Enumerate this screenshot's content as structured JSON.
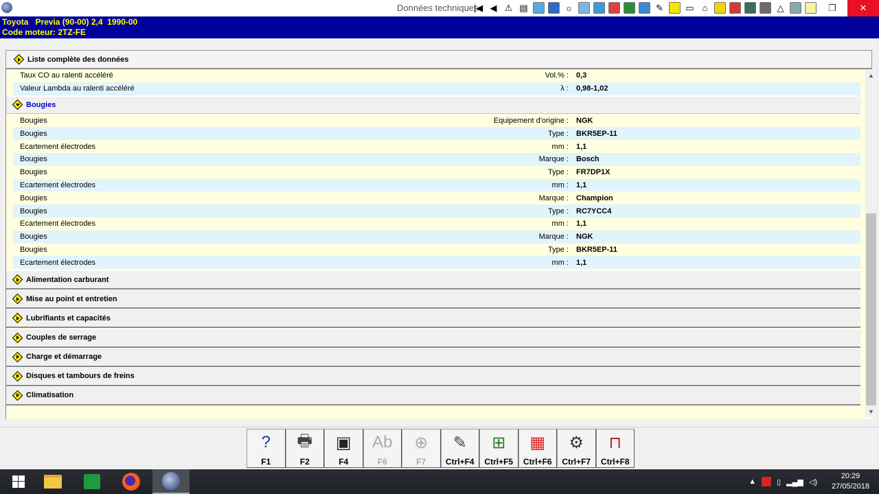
{
  "window": {
    "title": "Données techniques",
    "controls": {
      "restore": "❐",
      "close": "✕"
    }
  },
  "toolbar": {
    "icons": [
      {
        "name": "first-page-icon",
        "glyph": "|◀"
      },
      {
        "name": "previous-icon",
        "glyph": "◀"
      },
      {
        "name": "warning-icon",
        "glyph": "⚠"
      },
      {
        "name": "document-icon",
        "glyph": "▤"
      },
      {
        "name": "diagram-icon",
        "color": "#5aa8e0"
      },
      {
        "name": "globe-icon",
        "color": "#2b6cc4"
      },
      {
        "name": "bulb-icon",
        "glyph": "☼"
      },
      {
        "name": "gauge-icon",
        "color": "#7ab6e6"
      },
      {
        "name": "car-lift-icon",
        "color": "#3c9ad6"
      },
      {
        "name": "battery-icon",
        "color": "#e04040"
      },
      {
        "name": "ramp-icon",
        "color": "#2c8a3c"
      },
      {
        "name": "engine-icon",
        "color": "#3a8ad0"
      },
      {
        "name": "pen-icon",
        "glyph": "✎"
      },
      {
        "name": "dashboard-icon",
        "color": "#f2e600"
      },
      {
        "name": "window-icon",
        "glyph": "▭"
      },
      {
        "name": "car-icon",
        "glyph": "⌂"
      },
      {
        "name": "face-icon",
        "color": "#f2d200"
      },
      {
        "name": "calculator-icon",
        "color": "#d23a3a"
      },
      {
        "name": "wheel-icon",
        "color": "#3f6b5a"
      },
      {
        "name": "tools-icon",
        "color": "#6b6b6b"
      },
      {
        "name": "triangle-icon",
        "glyph": "△"
      },
      {
        "name": "tire-icon",
        "color": "#8aa"
      },
      {
        "name": "notes-icon",
        "color": "#f6f0a0"
      }
    ]
  },
  "vehicle": {
    "line1": "Toyota   Previa (90-00) 2,4  1990-00",
    "line2": "Code moteur: 2TZ-FE"
  },
  "summary_title": "Liste complète des données",
  "top_rows": [
    {
      "name": "Taux CO au ralenti accéléré",
      "unit": "Vol.% :",
      "value": "0,3"
    },
    {
      "name": "Valeur Lambda au ralenti accéléré",
      "unit": "λ :",
      "value": "0,98-1,02"
    }
  ],
  "open_section": "Bougies",
  "bougies_rows": [
    {
      "name": "Bougies",
      "unit": "Equipement d'origine :",
      "value": "NGK"
    },
    {
      "name": "Bougies",
      "unit": "Type :",
      "value": "BKR5EP-11"
    },
    {
      "name": "Ecartement électrodes",
      "unit": "mm :",
      "value": "1,1"
    },
    {
      "name": "Bougies",
      "unit": "Marque :",
      "value": "Bosch"
    },
    {
      "name": "Bougies",
      "unit": "Type :",
      "value": "FR7DP1X"
    },
    {
      "name": "Ecartement électrodes",
      "unit": "mm :",
      "value": "1,1"
    },
    {
      "name": "Bougies",
      "unit": "Marque :",
      "value": "Champion"
    },
    {
      "name": "Bougies",
      "unit": "Type :",
      "value": "RC7YCC4"
    },
    {
      "name": "Ecartement électrodes",
      "unit": "mm :",
      "value": "1,1"
    },
    {
      "name": "Bougies",
      "unit": "Marque :",
      "value": "NGK"
    },
    {
      "name": "Bougies",
      "unit": "Type :",
      "value": "BKR5EP-11"
    },
    {
      "name": "Ecartement électrodes",
      "unit": "mm :",
      "value": "1,1"
    }
  ],
  "sections": [
    "Alimentation carburant",
    "Mise au point et entretien",
    "Lubrifiants et capacités",
    "Couples de serrage",
    "Charge et démarrage",
    "Disques et tambours de freins",
    "Climatisation"
  ],
  "function_keys": [
    {
      "label": "F1",
      "icon": "help-icon",
      "glyph": "?",
      "color": "#1d3c9a",
      "enabled": true
    },
    {
      "label": "F2",
      "icon": "printer-icon",
      "glyph": "🖶",
      "color": "#444",
      "enabled": true
    },
    {
      "label": "F4",
      "icon": "monitor-icon",
      "glyph": "▣",
      "color": "#222",
      "enabled": true
    },
    {
      "label": "F6",
      "icon": "text-icon",
      "glyph": "Ab",
      "color": "#aaa",
      "enabled": false
    },
    {
      "label": "F7",
      "icon": "search-icon",
      "glyph": "⊕",
      "color": "#aaa",
      "enabled": false
    },
    {
      "label": "Ctrl+F4",
      "icon": "edit-notes-icon",
      "glyph": "✎",
      "color": "#444",
      "enabled": true
    },
    {
      "label": "Ctrl+F5",
      "icon": "add-page-icon",
      "glyph": "⊞",
      "color": "#2a7a2a",
      "enabled": true
    },
    {
      "label": "Ctrl+F6",
      "icon": "calculator-icon",
      "glyph": "▦",
      "color": "#d22",
      "enabled": true
    },
    {
      "label": "Ctrl+F7",
      "icon": "service-timer-icon",
      "glyph": "⚙",
      "color": "#333",
      "enabled": true
    },
    {
      "label": "Ctrl+F8",
      "icon": "car-lift-icon",
      "glyph": "⊓",
      "color": "#b22",
      "enabled": true
    }
  ],
  "taskbar": {
    "time": "20:29",
    "date": "27/05/2018"
  }
}
